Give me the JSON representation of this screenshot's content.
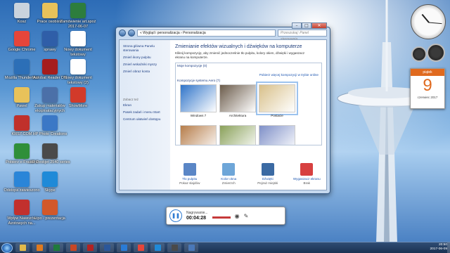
{
  "desktop": {
    "icons": [
      {
        "label": "Kosz",
        "color": "#c9d3dd"
      },
      {
        "label": "Google Chrome",
        "color": "#e6453a"
      },
      {
        "label": "Mozilla Thunderbird",
        "color": "#2c6fb7"
      },
      {
        "label": "Pawel",
        "color": "#e8c25a"
      },
      {
        "label": "KRS7.COM",
        "color": "#c0302b"
      },
      {
        "label": "Pobierz e-Fracture",
        "color": "#2f8f3a"
      },
      {
        "label": "Odstopa zawieszono",
        "color": "#2a85d8"
      },
      {
        "label": "Wpływ Nawozów Azotowych na...",
        "color": "#c2302d"
      },
      {
        "label": "Prace osobiste",
        "color": "#e8c25a"
      },
      {
        "label": "sprawy",
        "color": "#2f5ea8"
      },
      {
        "label": "Acrobat Reader DC",
        "color": "#a51d1d"
      },
      {
        "label": "Zakup materiałów eksploatacyjnych",
        "color": "#4b70a8"
      },
      {
        "label": "HP Photo Creations",
        "color": "#3b78c6"
      },
      {
        "label": "HP Deskjet 2540 series",
        "color": "#4a4a4a"
      },
      {
        "label": "Skype",
        "color": "#1f8ad8"
      },
      {
        "label": "Lipo - prezentacja",
        "color": "#d2582a"
      },
      {
        "label": "Zamówienie art.spoż 2017-06-07",
        "color": "#2d7d3d"
      },
      {
        "label": "Nowy dokument tekstowy",
        "color": "#ffffff"
      },
      {
        "label": "Nowy dokument tekstowy (2)",
        "color": "#ffffff"
      },
      {
        "label": "ShowMore",
        "color": "#d23a2a"
      }
    ],
    "calendar": {
      "weekday": "piątek",
      "day": "9",
      "month": "czerwiec 2017"
    }
  },
  "window": {
    "breadcrumb": "« Wygląd i personalizacja › Personalizacja",
    "search_placeholder": "Przeszukaj: Panel sterowania",
    "left_nav": {
      "home": "Strona główna Panelu sterowania",
      "links": [
        "Zmień ikony pulpitu",
        "Zmień wskaźniki myszy",
        "Zmień obraz konta"
      ],
      "see_also_heading": "Zobacz też",
      "see_also": [
        "Ekran",
        "Pasek zadań i menu Start",
        "Centrum ułatwień dostępu"
      ]
    },
    "main": {
      "title": "Zmienianie efektów wizualnych i dźwięków na komputerze",
      "description": "Kliknij kompozycję, aby zmienić jednocześnie tło pulpitu, kolory okien, dźwięki i wygaszacz ekranu na komputerze.",
      "my_themes": "Moje kompozycje (0)",
      "online_link": "Pobierz więcej kompozycji w trybie online",
      "aero_heading": "Kompozycje systemu Aero (7)",
      "themes": [
        {
          "name": "Windows 7",
          "color": "#2f74c9"
        },
        {
          "name": "Architektura",
          "color": "#6b5b4a"
        },
        {
          "name": "Postacie",
          "color": "#d8c08a"
        },
        {
          "name": "",
          "color": "#b67d4a"
        },
        {
          "name": "",
          "color": "#8aa15a"
        },
        {
          "name": "",
          "color": "#7f90c8"
        }
      ],
      "bottom_items": [
        {
          "label": "Tło pulpitu",
          "value": "Pokaz slajdów",
          "color": "#5a86c6"
        },
        {
          "label": "Kolor okna",
          "value": "Zmierzch",
          "color": "#6ea6d8"
        },
        {
          "label": "Dźwięki",
          "value": "Pejzaż miejski",
          "color": "#3b6aa3"
        },
        {
          "label": "Wygaszacz ekranu",
          "value": "Brak",
          "color": "#d74040"
        }
      ]
    }
  },
  "recorder": {
    "status": "Nagrywanie...",
    "time": "00:04:28"
  },
  "taskbar": {
    "apps": [
      {
        "name": "explorer-icon",
        "color": "#e2b94a"
      },
      {
        "name": "media-player-icon",
        "color": "#e07a1f"
      },
      {
        "name": "excel-icon",
        "color": "#1f7a3c"
      },
      {
        "name": "powerpoint-icon",
        "color": "#c74725"
      },
      {
        "name": "acrobat-icon",
        "color": "#b22222"
      },
      {
        "name": "word-icon",
        "color": "#2b579a"
      },
      {
        "name": "ie-icon",
        "color": "#2a7bd5"
      },
      {
        "name": "chrome-icon",
        "color": "#e6453a"
      },
      {
        "name": "skype-icon",
        "color": "#1f8ad8"
      },
      {
        "name": "game-icon",
        "color": "#4a4a4a"
      },
      {
        "name": "control-panel-icon",
        "color": "#4a78b8"
      }
    ],
    "time": "20:50",
    "date": "2017-06-09"
  }
}
